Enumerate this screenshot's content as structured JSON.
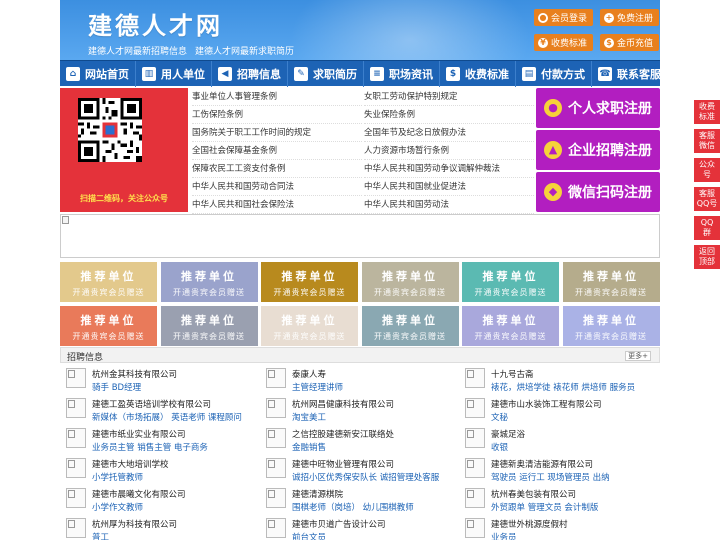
{
  "header": {
    "title": "建德人才网",
    "subtitle_1": "建德人才网最新招聘信息",
    "subtitle_2": "建德人才网最新求职简历",
    "buttons": {
      "login": "会员登录",
      "register": "免费注册",
      "fees": "收费标准",
      "recharge": "金币充值"
    }
  },
  "nav": [
    {
      "label": "网站首页",
      "icon": "home-icon"
    },
    {
      "label": "用人单位",
      "icon": "building-icon"
    },
    {
      "label": "招聘信息",
      "icon": "megaphone-icon"
    },
    {
      "label": "求职简历",
      "icon": "resume-icon"
    },
    {
      "label": "职场资讯",
      "icon": "news-icon"
    },
    {
      "label": "收费标准",
      "icon": "price-icon"
    },
    {
      "label": "付款方式",
      "icon": "card-icon"
    },
    {
      "label": "联系客服",
      "icon": "phone-icon"
    }
  ],
  "qr": {
    "caption": "扫描二维码，关注公众号"
  },
  "links_left": [
    "事业单位人事管理条例",
    "工伤保险条例",
    "国务院关于职工工作时间的规定",
    "全国社会保障基金条例",
    "保障农民工工资支付条例",
    "中华人民共和国劳动合同法",
    "中华人民共和国社会保险法"
  ],
  "links_right": [
    "女职工劳动保护特别规定",
    "失业保险条例",
    "全国年节及纪念日放假办法",
    "人力资源市场暂行条例",
    "中华人民共和国劳动争议调解仲裁法",
    "中华人民共和国就业促进法",
    "中华人民共和国劳动法"
  ],
  "register": {
    "personal": "个人求职注册",
    "company": "企业招聘注册",
    "wechat": "微信扫码注册"
  },
  "recommend": {
    "title": "推荐单位",
    "subtitle": "开通贵宾会员赠送",
    "colors": [
      "#e3c98c",
      "#9aa3cc",
      "#b88a1e",
      "#bbb59e",
      "#5bbab2",
      "#b5ac8c",
      "#e97a5a",
      "#9aa0b0",
      "#e8ddd2",
      "#8aa8b2",
      "#a9a8dc",
      "#aab2e6"
    ]
  },
  "jobs": {
    "heading": "招聘信息",
    "more": "更多+",
    "columns": [
      [
        {
          "company": "杭州金其科技有限公司",
          "positions": "骑手 BD经理"
        },
        {
          "company": "建德工盈英语培训学校有限公司",
          "positions": "新媒体（市场拓展） 英语老师 课程顾问"
        },
        {
          "company": "建德市纸业实业有限公司",
          "positions": "业务员主管 销售主管 电子商务"
        },
        {
          "company": "建德市大地培训学校",
          "positions": "小学托管教师"
        },
        {
          "company": "建德市晨曦文化有限公司",
          "positions": "小学作文教师"
        },
        {
          "company": "杭州厚为科技有限公司",
          "positions": "普工"
        }
      ],
      [
        {
          "company": "泰康人寿",
          "positions": "主管经理讲师"
        },
        {
          "company": "杭州网昌健康科技有限公司",
          "positions": "淘宝美工"
        },
        {
          "company": "之信控股建德新安江联络处",
          "positions": "金融销售"
        },
        {
          "company": "建德中旺物业管理有限公司",
          "positions": "诚招小区优秀保安队长 诚招管理处客服"
        },
        {
          "company": "建德清源棋院",
          "positions": "围棋老师（岗培） 幼儿围棋教师"
        },
        {
          "company": "建德市贝道广告设计公司",
          "positions": "前台文员"
        }
      ],
      [
        {
          "company": "十九号古斋",
          "positions": "裱花，烘培学徒 裱花师 烘培师 服务员"
        },
        {
          "company": "建德市山水装饰工程有限公司",
          "positions": "文秘"
        },
        {
          "company": "豪城足浴",
          "positions": "收银"
        },
        {
          "company": "建德新奥清洁能源有限公司",
          "positions": "驾驶员 运行工 现场管理员 出纳"
        },
        {
          "company": "杭州春美包装有限公司",
          "positions": "外贸跟单 管理文员 会计制版"
        },
        {
          "company": "建德世外桃源度假村",
          "positions": "业务员"
        }
      ]
    ]
  },
  "side_float": [
    "收费标准",
    "客服微信",
    "公众号",
    "客服QQ号",
    "QQ群",
    "返回顶部"
  ]
}
